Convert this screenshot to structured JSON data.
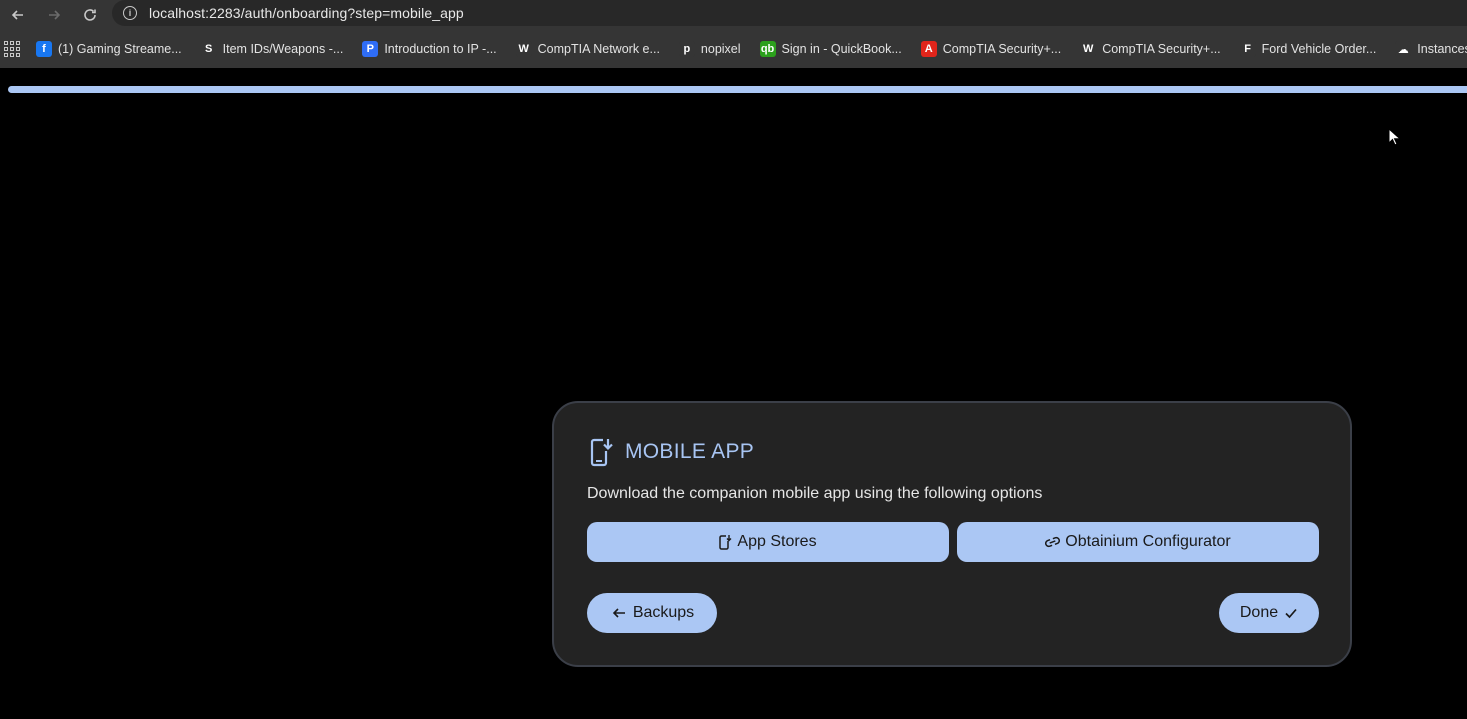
{
  "browser": {
    "url": "localhost:2283/auth/onboarding?step=mobile_app",
    "bookmarks": [
      {
        "label": "(1) Gaming Streame...",
        "icon": "facebook-icon",
        "color": "#1877f2",
        "glyph": "f"
      },
      {
        "label": "Item IDs/Weapons -...",
        "icon": "s-logo-icon",
        "color": "#353535",
        "glyph": "S"
      },
      {
        "label": "Introduction to IP -...",
        "icon": "pearson-icon",
        "color": "#2f6df6",
        "glyph": "P"
      },
      {
        "label": "CompTIA Network e...",
        "icon": "wordpress-icon",
        "color": "#353535",
        "glyph": "W"
      },
      {
        "label": "nopixel",
        "icon": "nopixel-icon",
        "color": "#353535",
        "glyph": "p"
      },
      {
        "label": "Sign in - QuickBook...",
        "icon": "quickbooks-icon",
        "color": "#2ca01c",
        "glyph": "qb"
      },
      {
        "label": "CompTIA Security+...",
        "icon": "adobe-icon",
        "color": "#e1251b",
        "glyph": "A"
      },
      {
        "label": "CompTIA Security+...",
        "icon": "wordpress-icon",
        "color": "#353535",
        "glyph": "W"
      },
      {
        "label": "Ford Vehicle Order...",
        "icon": "ford-icon",
        "color": "#353535",
        "glyph": "F"
      },
      {
        "label": "Instances | Oracl",
        "icon": "cloud-icon",
        "color": "#353535",
        "glyph": "☁"
      }
    ]
  },
  "onboarding": {
    "progress": 1.0,
    "title": "MOBILE APP",
    "description": "Download the companion mobile app using the following options",
    "app_stores_label": "App Stores",
    "obtainium_label": "Obtainium Configurator",
    "back_label": "Backups",
    "done_label": "Done",
    "accent_color": "#abc7f4"
  }
}
